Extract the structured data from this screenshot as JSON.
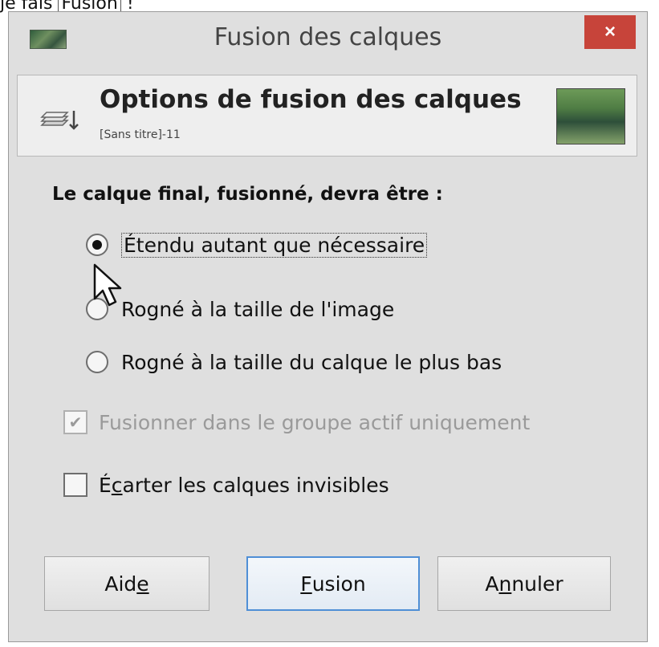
{
  "caption": {
    "prefix": "je fais",
    "highlighted": "Fusion",
    "suffix": "!"
  },
  "window": {
    "title": "Fusion des calques",
    "close_label": "×"
  },
  "header": {
    "title": "Options de fusion des calques",
    "subtitle": "[Sans titre]-11"
  },
  "options": {
    "label": "Le calque final, fusionné, devra être :",
    "radios": [
      {
        "label": "Étendu autant que nécessaire",
        "checked": true
      },
      {
        "label": "Rogné à la taille de l'image",
        "checked": false
      },
      {
        "label": "Rogné à la taille du calque le plus bas",
        "checked": false
      }
    ]
  },
  "checkboxes": {
    "active_group": {
      "label": "Fusionner dans le groupe actif uniquement",
      "checked": true,
      "enabled": false
    },
    "discard_invisible": {
      "prefix": "É",
      "mnemonic": "c",
      "rest": "arter les calques invisibles",
      "checked": false
    }
  },
  "buttons": {
    "help": {
      "prefix": "Aid",
      "mnemonic": "e",
      "rest": ""
    },
    "merge": {
      "prefix": "",
      "mnemonic": "F",
      "rest": "usion"
    },
    "cancel": {
      "prefix": "A",
      "mnemonic": "n",
      "rest": "nuler"
    }
  },
  "colors": {
    "close": "#c7443a",
    "default_button_border": "#4f8fd6"
  },
  "icons": {
    "header": "merge-layers-icon",
    "cursor": "mouse-pointer-icon"
  }
}
